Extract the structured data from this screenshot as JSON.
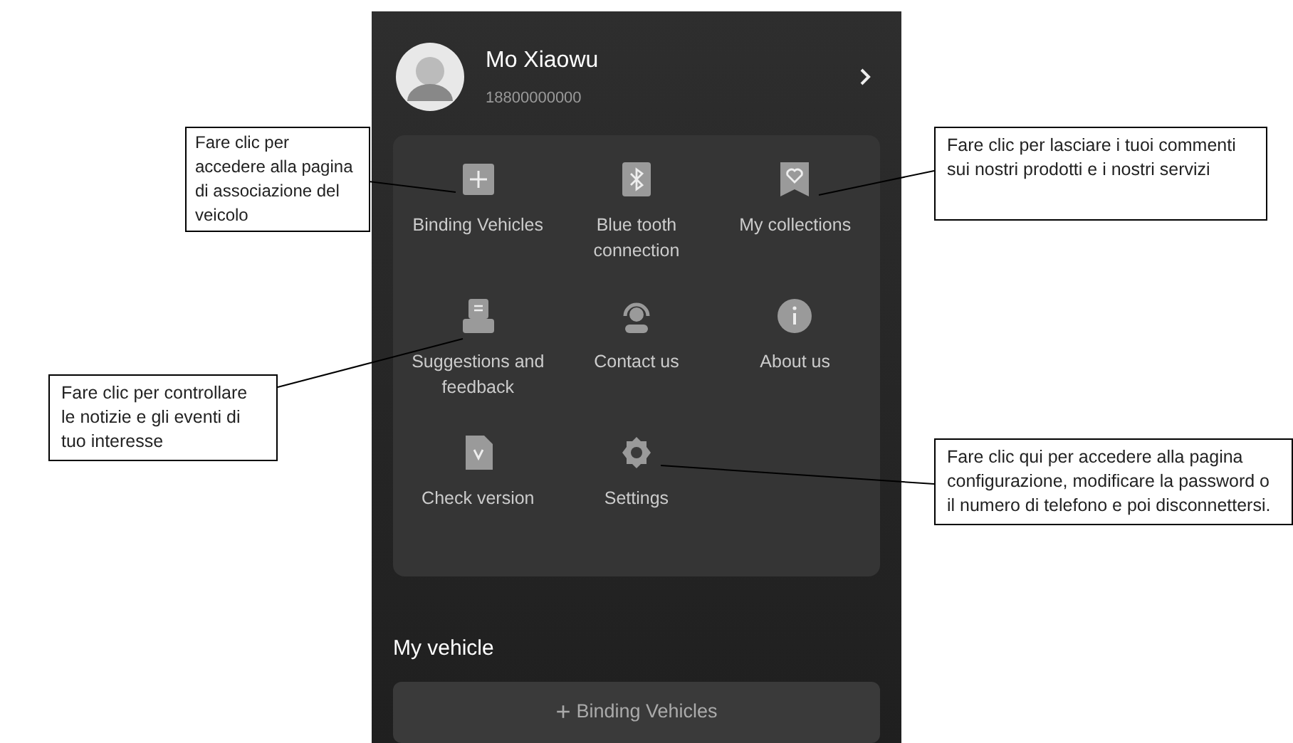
{
  "profile": {
    "name": "Mo Xiaowu",
    "phone": "18800000000"
  },
  "menu": [
    {
      "label": "Binding Vehicles",
      "kind": "plus"
    },
    {
      "label": "Blue tooth connection",
      "kind": "bluetooth"
    },
    {
      "label": "My collections",
      "kind": "heart"
    },
    {
      "label": "Suggestions and feedback",
      "kind": "feedback"
    },
    {
      "label": "Contact us",
      "kind": "headset"
    },
    {
      "label": "About us",
      "kind": "info"
    },
    {
      "label": "Check version",
      "kind": "version"
    },
    {
      "label": "Settings",
      "kind": "gear"
    }
  ],
  "my_vehicle": {
    "title": "My vehicle",
    "button_icon": "+",
    "button": "Binding Vehicles"
  },
  "callouts": [
    {
      "text": "Fare clic per accedere alla pagina di associazione del veicolo"
    },
    {
      "text": "Fare clic per lasciare i tuoi commenti sui nostri prodotti e i nostri servizi"
    },
    {
      "text": "Fare clic per controllare le notizie e gli eventi di tuo interesse"
    },
    {
      "text": "Fare clic qui per accedere alla pagina configurazione, modificare la password o il numero di telefono e poi disconnettersi."
    }
  ]
}
